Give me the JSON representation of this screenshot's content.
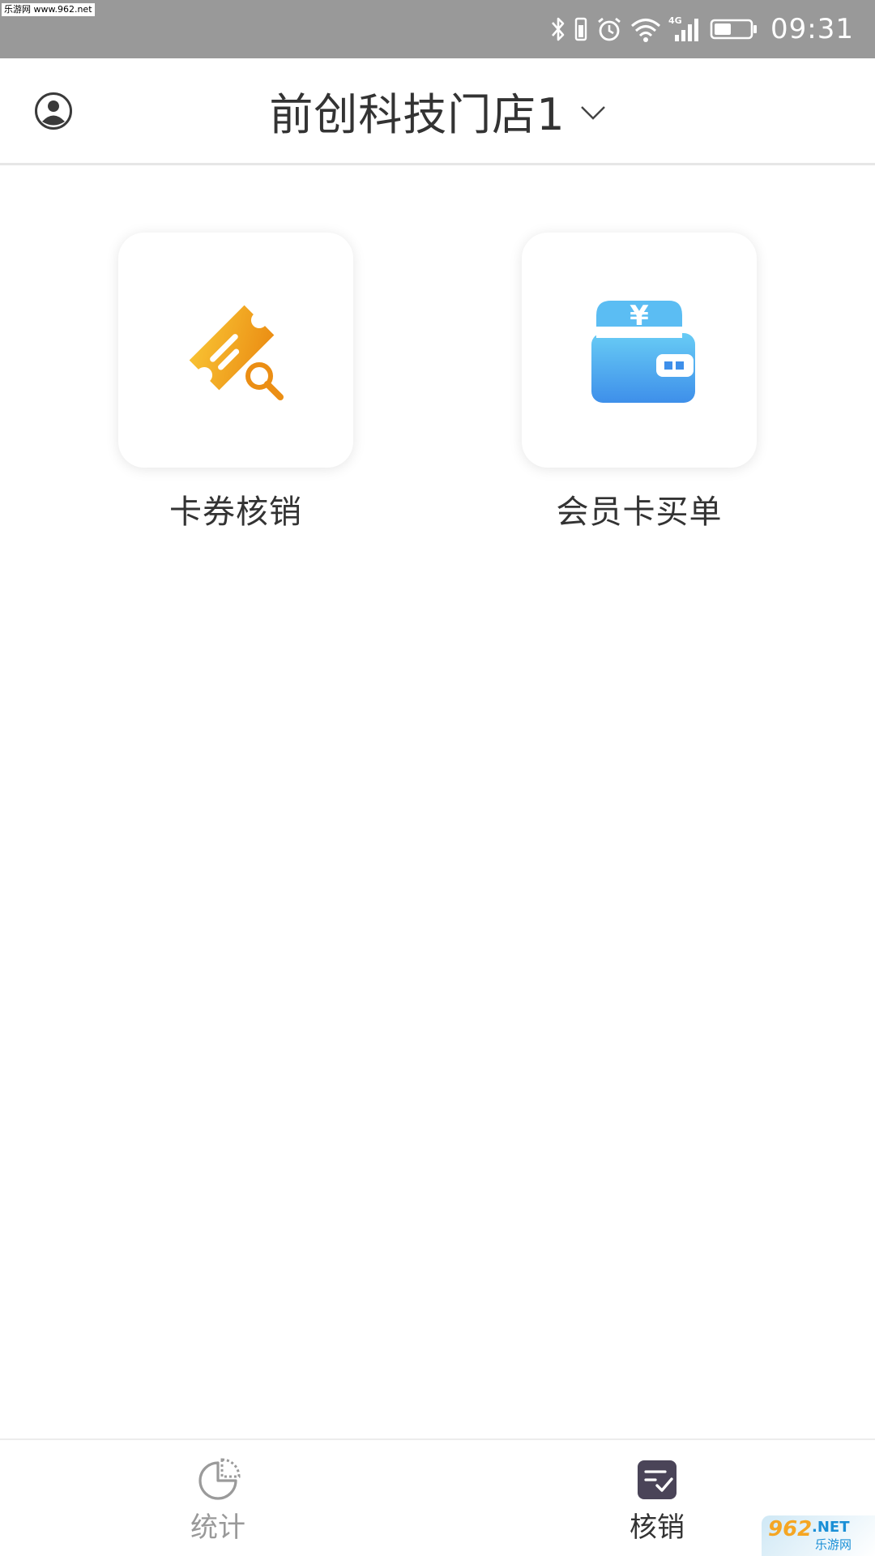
{
  "status_bar": {
    "watermark": "乐游网 www.962.net",
    "time": "09:31",
    "network": "4G"
  },
  "header": {
    "store_name": "前创科技门店1"
  },
  "tiles": [
    {
      "label": "卡券核销",
      "icon": "ticket-search-icon",
      "color": "#F2A21B"
    },
    {
      "label": "会员卡买单",
      "icon": "wallet-yuan-icon",
      "color": "#4BA3F0"
    }
  ],
  "bottom_nav": {
    "items": [
      {
        "label": "统计",
        "icon": "pie-chart-icon",
        "active": false
      },
      {
        "label": "核销",
        "icon": "checklist-icon",
        "active": true
      }
    ],
    "active_color": "#333333",
    "inactive_color": "#999999"
  },
  "watermark_bottom": {
    "logo": "962",
    "net": ".NET",
    "site": "乐游网"
  }
}
